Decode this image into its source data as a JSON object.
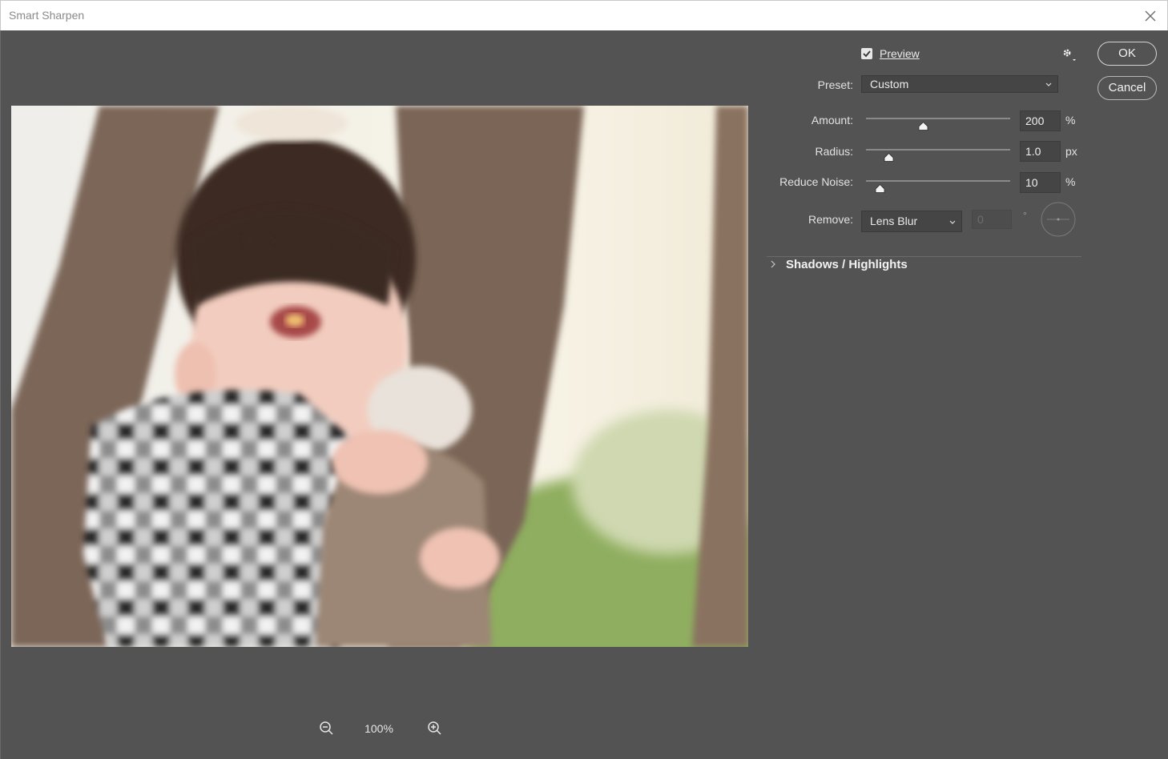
{
  "window": {
    "title": "Smart Sharpen"
  },
  "controls": {
    "preview_label": "Preview",
    "preview_checked": true,
    "preset_label": "Preset:",
    "preset_value": "Custom",
    "amount_label": "Amount:",
    "amount_value": "200",
    "amount_unit": "%",
    "radius_label": "Radius:",
    "radius_value": "1.0",
    "radius_unit": "px",
    "reduce_noise_label": "Reduce Noise:",
    "reduce_noise_value": "10",
    "reduce_noise_unit": "%",
    "remove_label": "Remove:",
    "remove_value": "Lens Blur",
    "angle_value": "0",
    "angle_unit": "°",
    "section_label": "Shadows / Highlights"
  },
  "buttons": {
    "ok": "OK",
    "cancel": "Cancel"
  },
  "zoom": {
    "level": "100%"
  },
  "slider_levels": {
    "amount_fraction": 0.4,
    "radius_fraction": 0.16,
    "reduce_noise_fraction": 0.1
  },
  "icons": [
    "close-icon",
    "gear-icon",
    "zoom-out-icon",
    "zoom-in-icon",
    "chevron-down-icon",
    "chevron-right-icon",
    "checkbox-check-icon",
    "angle-dial-icon"
  ],
  "colors": {
    "dialog_bg": "#535353",
    "titlebar_bg": "#ffffff",
    "field_bg": "#454545"
  }
}
